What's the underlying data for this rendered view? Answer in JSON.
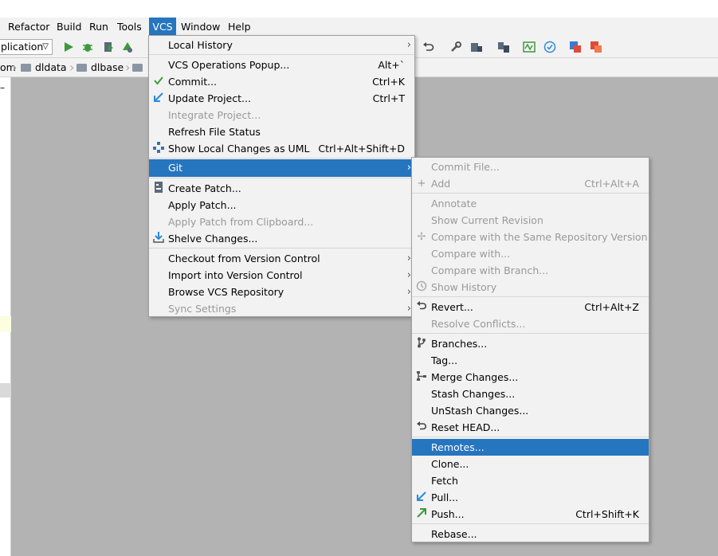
{
  "menubar": {
    "items": [
      {
        "label": "Refactor"
      },
      {
        "label": "Build"
      },
      {
        "label": "Run"
      },
      {
        "label": "Tools"
      },
      {
        "label": "VCS"
      },
      {
        "label": "Window"
      },
      {
        "label": "Help"
      }
    ]
  },
  "toolbar": {
    "run_config": "plication"
  },
  "breadcrumbs": [
    "om",
    "dldata",
    "dlbase"
  ],
  "vcs_menu": [
    {
      "label": "Local History",
      "shortcut": "",
      "submenu": true
    },
    {
      "label": "VCS Operations Popup...",
      "shortcut": "Alt+`"
    },
    {
      "label": "Commit...",
      "shortcut": "Ctrl+K"
    },
    {
      "label": "Update Project...",
      "shortcut": "Ctrl+T"
    },
    {
      "label": "Integrate Project...",
      "shortcut": ""
    },
    {
      "label": "Refresh File Status",
      "shortcut": ""
    },
    {
      "label": "Show Local Changes as UML",
      "shortcut": "Ctrl+Alt+Shift+D"
    },
    {
      "label": "Git",
      "shortcut": "",
      "submenu": true
    },
    {
      "label": "Create Patch...",
      "shortcut": ""
    },
    {
      "label": "Apply Patch...",
      "shortcut": ""
    },
    {
      "label": "Apply Patch from Clipboard...",
      "shortcut": ""
    },
    {
      "label": "Shelve Changes...",
      "shortcut": ""
    },
    {
      "label": "Checkout from Version Control",
      "shortcut": "",
      "submenu": true
    },
    {
      "label": "Import into Version Control",
      "shortcut": "",
      "submenu": true
    },
    {
      "label": "Browse VCS Repository",
      "shortcut": "",
      "submenu": true
    },
    {
      "label": "Sync Settings",
      "shortcut": "",
      "submenu": true
    }
  ],
  "git_menu": [
    {
      "label": "Commit File...",
      "shortcut": ""
    },
    {
      "label": "Add",
      "shortcut": "Ctrl+Alt+A"
    },
    {
      "label": "Annotate",
      "shortcut": ""
    },
    {
      "label": "Show Current Revision",
      "shortcut": ""
    },
    {
      "label": "Compare with the Same Repository Version",
      "shortcut": ""
    },
    {
      "label": "Compare with...",
      "shortcut": ""
    },
    {
      "label": "Compare with Branch...",
      "shortcut": ""
    },
    {
      "label": "Show History",
      "shortcut": ""
    },
    {
      "label": "Revert...",
      "shortcut": "Ctrl+Alt+Z"
    },
    {
      "label": "Resolve Conflicts...",
      "shortcut": ""
    },
    {
      "label": "Branches...",
      "shortcut": ""
    },
    {
      "label": "Tag...",
      "shortcut": ""
    },
    {
      "label": "Merge Changes...",
      "shortcut": ""
    },
    {
      "label": "Stash Changes...",
      "shortcut": ""
    },
    {
      "label": "UnStash Changes...",
      "shortcut": ""
    },
    {
      "label": "Reset HEAD...",
      "shortcut": ""
    },
    {
      "label": "Remotes...",
      "shortcut": ""
    },
    {
      "label": "Clone...",
      "shortcut": ""
    },
    {
      "label": "Fetch",
      "shortcut": ""
    },
    {
      "label": "Pull...",
      "shortcut": ""
    },
    {
      "label": "Push...",
      "shortcut": "Ctrl+Shift+K"
    },
    {
      "label": "Rebase...",
      "shortcut": ""
    }
  ],
  "colors": {
    "highlight": "#2675bf",
    "menu_bg": "#f2f2f2",
    "editor_bg": "#b3b3b3"
  }
}
